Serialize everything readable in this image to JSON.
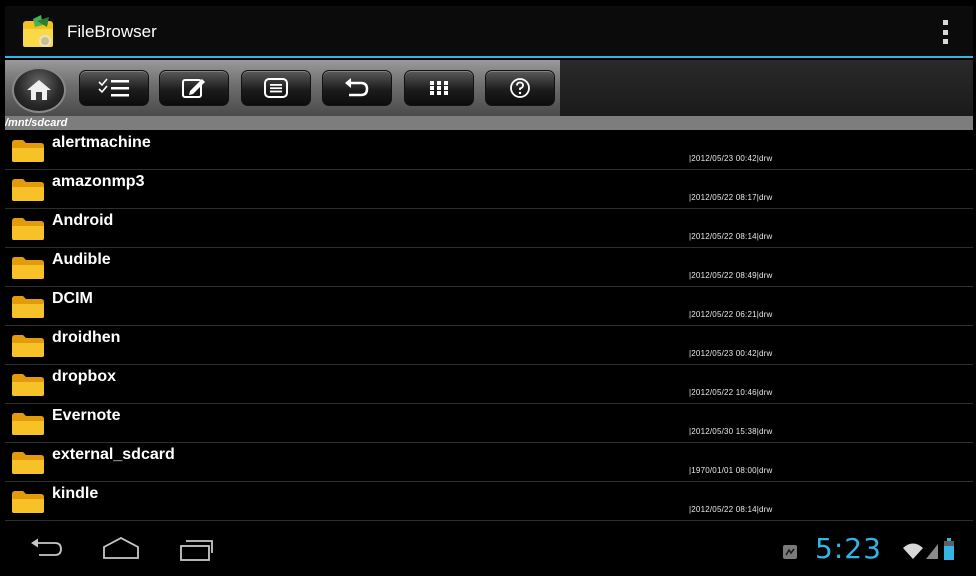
{
  "app": {
    "title": "FileBrowser"
  },
  "path": "/mnt/sdcard",
  "files": [
    {
      "name": "alertmachine",
      "meta": "|2012/05/23 00:42|drw"
    },
    {
      "name": "amazonmp3",
      "meta": "|2012/05/22 08:17|drw"
    },
    {
      "name": "Android",
      "meta": "|2012/05/22 08:14|drw"
    },
    {
      "name": "Audible",
      "meta": "|2012/05/22 08:49|drw"
    },
    {
      "name": "DCIM",
      "meta": "|2012/05/22 06:21|drw"
    },
    {
      "name": "droidhen",
      "meta": "|2012/05/23 00:42|drw"
    },
    {
      "name": "dropbox",
      "meta": "|2012/05/22 10:46|drw"
    },
    {
      "name": "Evernote",
      "meta": "|2012/05/30 15:38|drw"
    },
    {
      "name": "external_sdcard",
      "meta": "|1970/01/01 08:00|drw"
    },
    {
      "name": "kindle",
      "meta": "|2012/05/22 08:14|drw"
    }
  ],
  "statusbar": {
    "time": "5:23"
  },
  "colors": {
    "accent": "#33b5e5",
    "folder": "#f7b81a"
  },
  "toolbar_icons": [
    "home-icon",
    "multi-select-icon",
    "edit-icon",
    "list-icon",
    "back-arrow-icon",
    "grid-icon",
    "help-icon"
  ]
}
